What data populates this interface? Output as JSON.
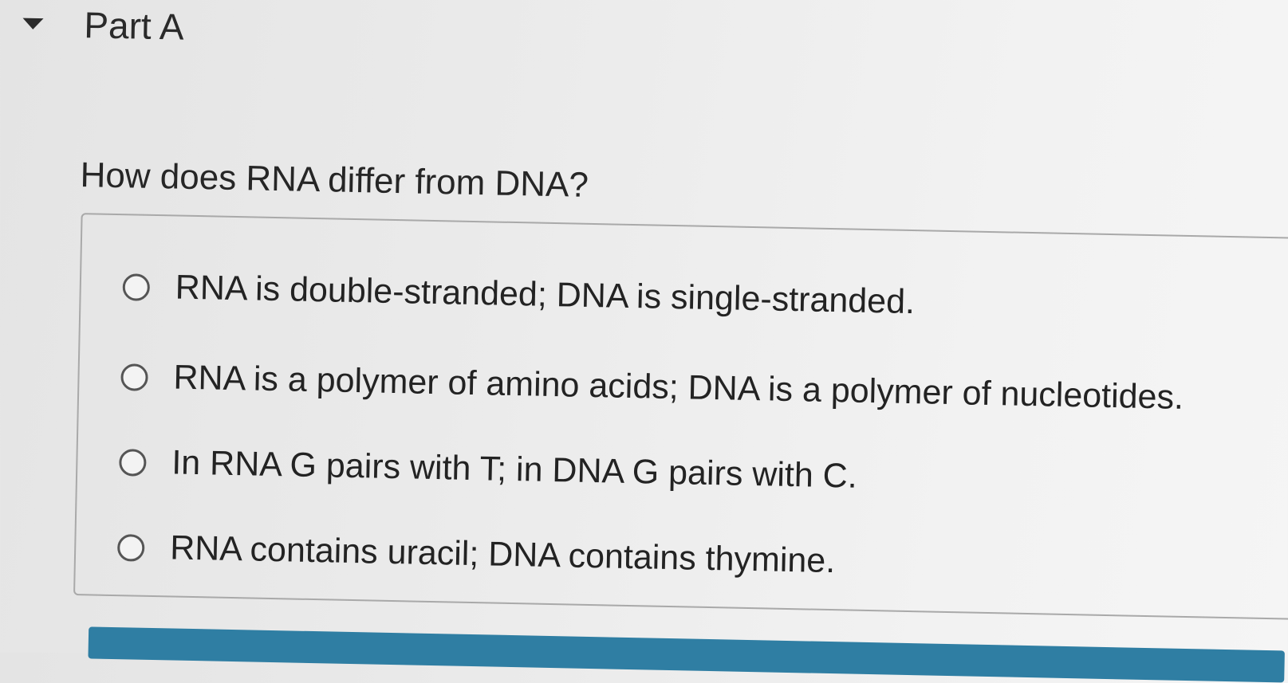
{
  "part": {
    "title": "Part A",
    "toggle_icon": "caret-down-icon"
  },
  "question": {
    "text": "How does RNA differ from DNA?"
  },
  "options": [
    {
      "label": "RNA is double-stranded; DNA is single-stranded.",
      "selected": false
    },
    {
      "label": "RNA is a polymer of amino acids; DNA is a polymer of nucleotides.",
      "selected": false
    },
    {
      "label": "In RNA G pairs with T; in DNA G pairs with C.",
      "selected": false
    },
    {
      "label": "RNA contains uracil; DNA contains thymine.",
      "selected": false
    }
  ],
  "colors": {
    "submit_bar": "#2f7ea3",
    "box_border": "#a9a9a9"
  }
}
